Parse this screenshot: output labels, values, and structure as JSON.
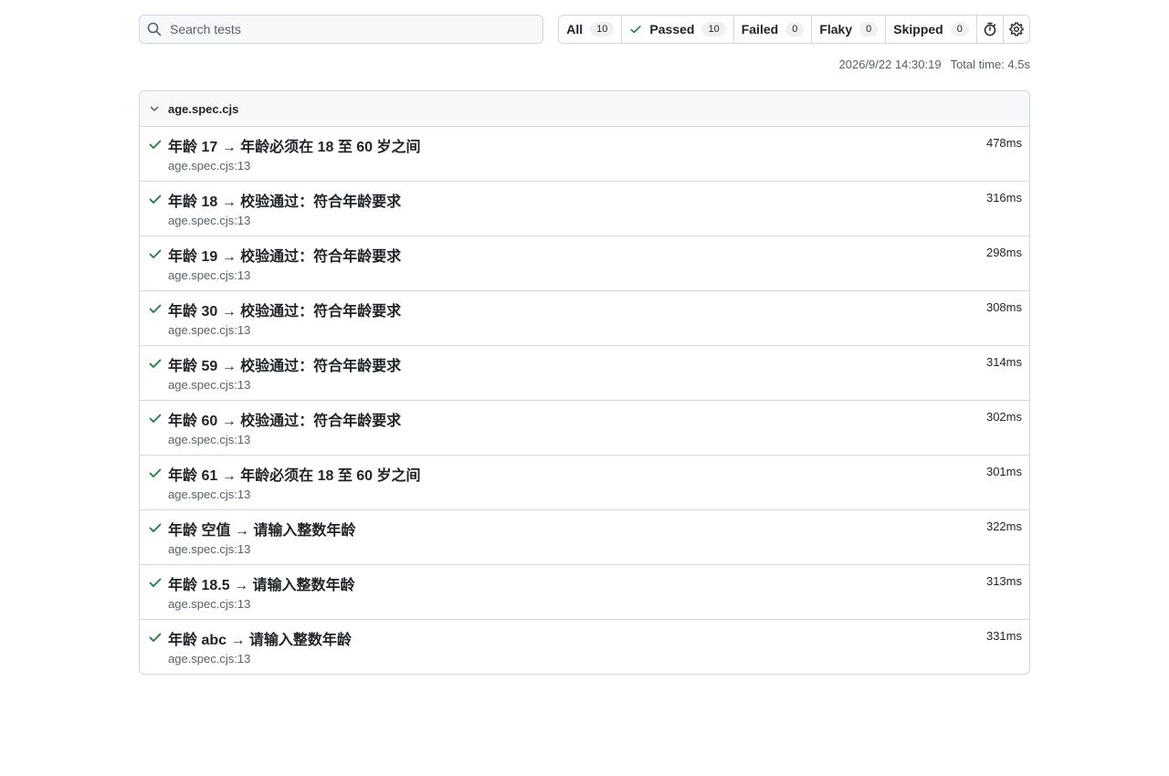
{
  "search": {
    "placeholder": "Search tests",
    "value": ""
  },
  "filters": [
    {
      "label": "All",
      "count": "10"
    },
    {
      "label": "Passed",
      "count": "10"
    },
    {
      "label": "Failed",
      "count": "0"
    },
    {
      "label": "Flaky",
      "count": "0"
    },
    {
      "label": "Skipped",
      "count": "0"
    }
  ],
  "meta": {
    "timestamp": "2026/9/22 14:30:19",
    "total_time": "Total time: 4.5s"
  },
  "file": {
    "name": "age.spec.cjs",
    "tests": [
      {
        "title": "年龄 17 → 年龄必须在 18 至 60 岁之间",
        "location": "age.spec.cjs:13",
        "duration": "478ms",
        "status": "passed"
      },
      {
        "title": "年龄 18 → 校验通过：符合年龄要求",
        "location": "age.spec.cjs:13",
        "duration": "316ms",
        "status": "passed"
      },
      {
        "title": "年龄 19 → 校验通过：符合年龄要求",
        "location": "age.spec.cjs:13",
        "duration": "298ms",
        "status": "passed"
      },
      {
        "title": "年龄 30 → 校验通过：符合年龄要求",
        "location": "age.spec.cjs:13",
        "duration": "308ms",
        "status": "passed"
      },
      {
        "title": "年龄 59 → 校验通过：符合年龄要求",
        "location": "age.spec.cjs:13",
        "duration": "314ms",
        "status": "passed"
      },
      {
        "title": "年龄 60 → 校验通过：符合年龄要求",
        "location": "age.spec.cjs:13",
        "duration": "302ms",
        "status": "passed"
      },
      {
        "title": "年龄 61 → 年龄必须在 18 至 60 岁之间",
        "location": "age.spec.cjs:13",
        "duration": "301ms",
        "status": "passed"
      },
      {
        "title": "年龄 空值 → 请输入整数年龄",
        "location": "age.spec.cjs:13",
        "duration": "322ms",
        "status": "passed"
      },
      {
        "title": "年龄 18.5 → 请输入整数年龄",
        "location": "age.spec.cjs:13",
        "duration": "313ms",
        "status": "passed"
      },
      {
        "title": "年龄 abc → 请输入整数年龄",
        "location": "age.spec.cjs:13",
        "duration": "331ms",
        "status": "passed"
      }
    ]
  },
  "icons": {
    "search": "search-icon",
    "passed": "check-icon",
    "timer": "stopwatch-icon",
    "settings": "gear-icon",
    "collapse": "chevron-down-icon"
  },
  "colors": {
    "passed": "#1a7f37",
    "border": "#d0d7de",
    "muted": "#57606a"
  }
}
